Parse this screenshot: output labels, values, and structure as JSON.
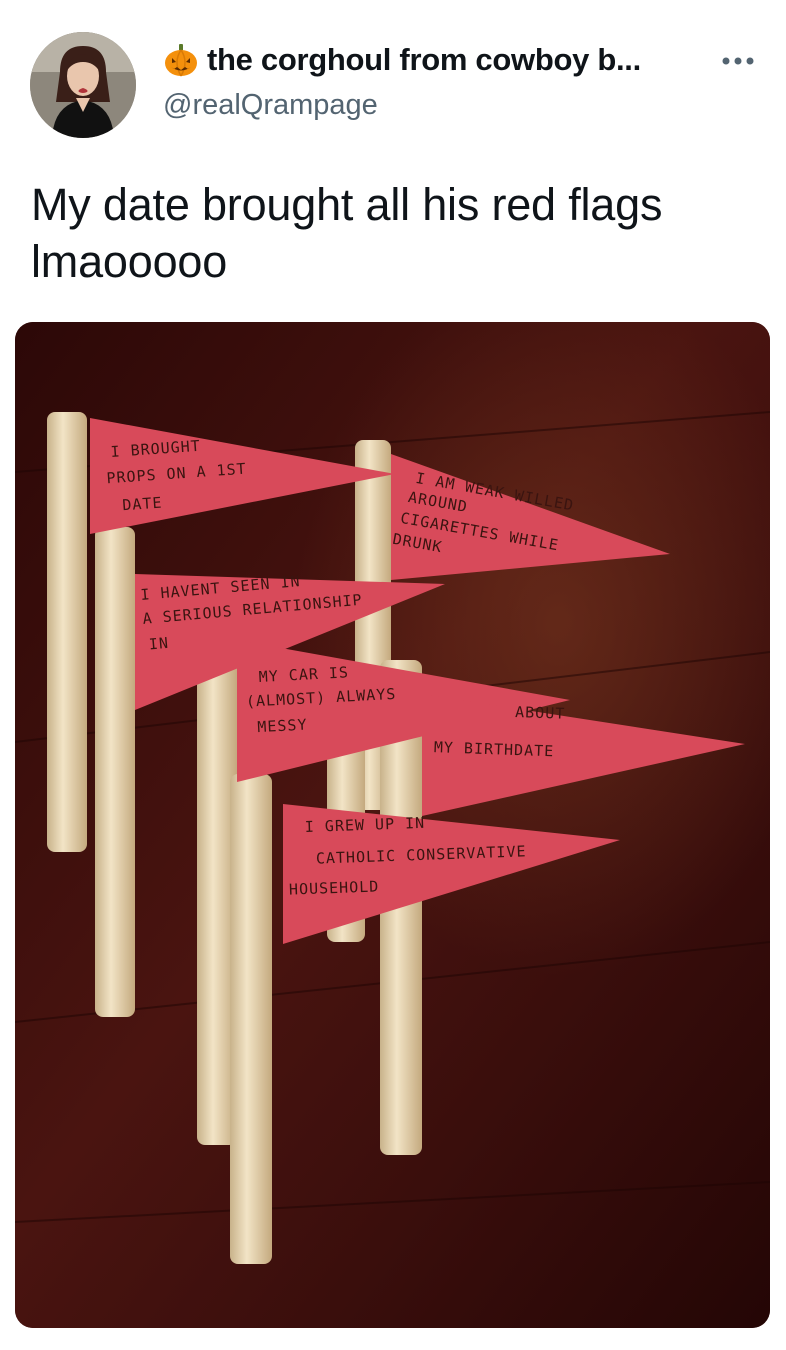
{
  "tweet": {
    "display_name": "the corghoul from cowboy b...",
    "handle": "@realQrampage",
    "text": "My date brought all his red flags lmaooooo",
    "more_label": "•••"
  },
  "flags": [
    {
      "lines": [
        "I BROUGHT",
        "PROPS ON A 1ST",
        "DATE"
      ]
    },
    {
      "lines": [
        "I AM WEAK WILLED",
        "AROUND",
        "CIGARETTES WHILE",
        "DRUNK"
      ]
    },
    {
      "lines": [
        "I HAVENT SEEN IN",
        "A SERIOUS RELATIONSHIP",
        "IN"
      ]
    },
    {
      "lines": [
        "MY CAR IS",
        "(ALMOST) ALWAYS",
        "MESSY"
      ]
    },
    {
      "lines": [
        "ABOUT",
        "MY BIRTHDATE"
      ]
    },
    {
      "lines": [
        "I GREW UP IN",
        "CATHOLIC CONSERVATIVE",
        "HOUSEHOLD"
      ]
    }
  ],
  "colors": {
    "pennant": "#d84a5a",
    "dowel": "#e8d6b4",
    "table": "#3a0d0b"
  }
}
